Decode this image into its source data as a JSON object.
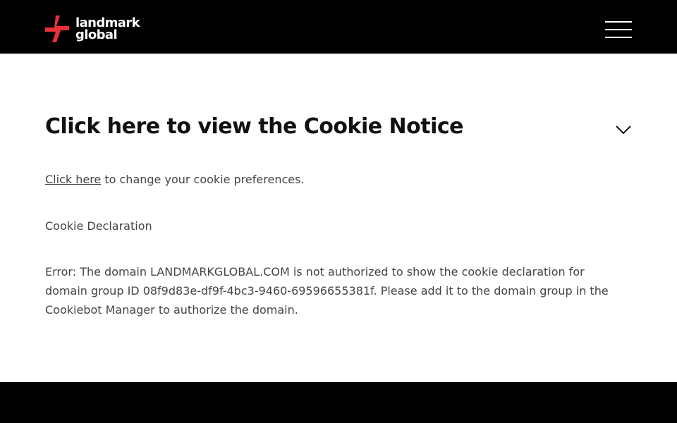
{
  "header": {
    "logo": {
      "line1": "landmark",
      "line2": "global",
      "brand_color": "#e8313b",
      "icon": "landmark-global-logo-mark"
    },
    "menu_icon": "hamburger-menu-icon"
  },
  "accordion": {
    "title": "Click here to view the Cookie Notice",
    "toggle_icon": "chevron-down-icon"
  },
  "content": {
    "preferences_link": "Click here",
    "preferences_text": " to change your cookie preferences.",
    "declaration_heading": "Cookie Declaration",
    "error_message": "Error: The domain LANDMARKGLOBAL.COM is not authorized to show the cookie declaration for domain group ID 08f9d83e-df9f-4bc3-9460-69596655381f. Please add it to the domain group in the Cookiebot Manager to authorize the domain."
  },
  "colors": {
    "header_bg": "#000000",
    "footer_bg": "#000000",
    "text": "#444444",
    "title": "#111111"
  }
}
